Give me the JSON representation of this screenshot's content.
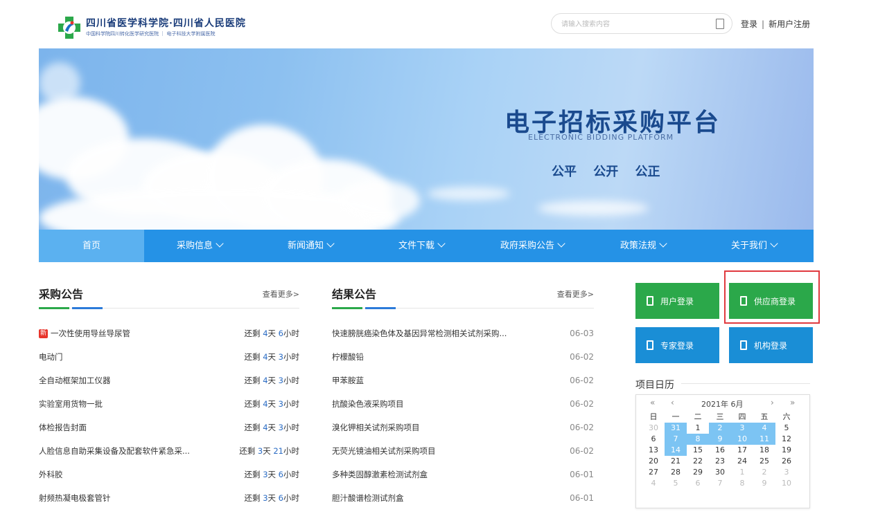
{
  "header": {
    "logo_title": "四川省医学科学院·四川省人民医院",
    "logo_sub": "中国科学院四川转化医学研究医院 ｜ 电子科技大学附属医院",
    "search_placeholder": "请输入搜索内容",
    "login": "登录",
    "separator": "|",
    "register": "新用户注册"
  },
  "banner": {
    "title": "电子招标采购平台",
    "subtitle_en": "ELECTRONIC BIDDING PLATFORM",
    "motto": "公平 公开 公正"
  },
  "nav": {
    "items": [
      {
        "label": "首页",
        "dropdown": false
      },
      {
        "label": "采购信息",
        "dropdown": true
      },
      {
        "label": "新闻通知",
        "dropdown": true
      },
      {
        "label": "文件下载",
        "dropdown": true
      },
      {
        "label": "政府采购公告",
        "dropdown": true
      },
      {
        "label": "政策法规",
        "dropdown": true
      },
      {
        "label": "关于我们",
        "dropdown": true
      }
    ]
  },
  "procurement": {
    "title": "采购公告",
    "more": "查看更多>",
    "new_tag": "新",
    "rows": [
      {
        "title": "一次性使用导丝导尿管",
        "prefix": "还剩",
        "days": "4",
        "days_unit": "天",
        "hours": "6",
        "hours_unit": "小时",
        "is_new": true
      },
      {
        "title": "电动门",
        "prefix": "还剩",
        "days": "4",
        "days_unit": "天",
        "hours": "3",
        "hours_unit": "小时"
      },
      {
        "title": "全自动框架加工仪器",
        "prefix": "还剩",
        "days": "4",
        "days_unit": "天",
        "hours": "3",
        "hours_unit": "小时"
      },
      {
        "title": "实验室用货物一批",
        "prefix": "还剩",
        "days": "4",
        "days_unit": "天",
        "hours": "3",
        "hours_unit": "小时"
      },
      {
        "title": "体检报告封面",
        "prefix": "还剩",
        "days": "4",
        "days_unit": "天",
        "hours": "3",
        "hours_unit": "小时"
      },
      {
        "title": "人脸信息自助采集设备及配套软件紧急采...",
        "prefix": "还剩",
        "days": "3",
        "days_unit": "天",
        "hours": "21",
        "hours_unit": "小时"
      },
      {
        "title": "外科胶",
        "prefix": "还剩",
        "days": "3",
        "days_unit": "天",
        "hours": "6",
        "hours_unit": "小时"
      },
      {
        "title": "射频热凝电极套管针",
        "prefix": "还剩",
        "days": "3",
        "days_unit": "天",
        "hours": "6",
        "hours_unit": "小时"
      }
    ]
  },
  "results": {
    "title": "结果公告",
    "more": "查看更多>",
    "rows": [
      {
        "title": "快速膀胱癌染色体及基因异常检测相关试剂采购...",
        "date": "06-03"
      },
      {
        "title": "柠檬酸铅",
        "date": "06-02"
      },
      {
        "title": "甲苯胺蓝",
        "date": "06-02"
      },
      {
        "title": "抗酸染色液采购项目",
        "date": "06-02"
      },
      {
        "title": "溴化钾相关试剂采购项目",
        "date": "06-02"
      },
      {
        "title": "无荧光镜油相关试剂采购项目",
        "date": "06-02"
      },
      {
        "title": "多种类固醇激素检测试剂盒",
        "date": "06-01"
      },
      {
        "title": "胆汁酸谱检测试剂盒",
        "date": "06-01"
      }
    ]
  },
  "logins": {
    "user": "用户登录",
    "supplier": "供应商登录",
    "expert": "专家登录",
    "org": "机构登录"
  },
  "calendar": {
    "title": "项目日历",
    "month_label": "2021年  6月",
    "nav_prev_year": "«",
    "nav_prev": "‹",
    "nav_next": "›",
    "nav_next_year": "»",
    "weekdays": [
      "日",
      "一",
      "二",
      "三",
      "四",
      "五",
      "六"
    ],
    "days": [
      {
        "d": "30",
        "s": "o"
      },
      {
        "d": "31",
        "s": "h"
      },
      {
        "d": "1",
        "s": ""
      },
      {
        "d": "2",
        "s": "h"
      },
      {
        "d": "3",
        "s": "h"
      },
      {
        "d": "4",
        "s": "h"
      },
      {
        "d": "5",
        "s": ""
      },
      {
        "d": "6",
        "s": ""
      },
      {
        "d": "7",
        "s": "h"
      },
      {
        "d": "8",
        "s": "h"
      },
      {
        "d": "9",
        "s": "h"
      },
      {
        "d": "10",
        "s": "h"
      },
      {
        "d": "11",
        "s": "h"
      },
      {
        "d": "12",
        "s": ""
      },
      {
        "d": "13",
        "s": ""
      },
      {
        "d": "14",
        "s": "h"
      },
      {
        "d": "15",
        "s": ""
      },
      {
        "d": "16",
        "s": ""
      },
      {
        "d": "17",
        "s": ""
      },
      {
        "d": "18",
        "s": ""
      },
      {
        "d": "19",
        "s": ""
      },
      {
        "d": "20",
        "s": ""
      },
      {
        "d": "21",
        "s": ""
      },
      {
        "d": "22",
        "s": ""
      },
      {
        "d": "23",
        "s": ""
      },
      {
        "d": "24",
        "s": ""
      },
      {
        "d": "25",
        "s": ""
      },
      {
        "d": "26",
        "s": ""
      },
      {
        "d": "27",
        "s": ""
      },
      {
        "d": "28",
        "s": ""
      },
      {
        "d": "29",
        "s": ""
      },
      {
        "d": "30",
        "s": ""
      },
      {
        "d": "1",
        "s": "o"
      },
      {
        "d": "2",
        "s": "o"
      },
      {
        "d": "3",
        "s": "o"
      },
      {
        "d": "4",
        "s": "o"
      },
      {
        "d": "5",
        "s": "o"
      },
      {
        "d": "6",
        "s": "o"
      },
      {
        "d": "7",
        "s": "o"
      },
      {
        "d": "8",
        "s": "o"
      },
      {
        "d": "9",
        "s": "o"
      },
      {
        "d": "10",
        "s": "o"
      }
    ]
  },
  "colors": {
    "nav_bg": "#2592e6",
    "green": "#2ba84a",
    "blue": "#1a8ed6",
    "highlight_border": "#e0393e",
    "calendar_highlight": "#7cc4f3"
  }
}
